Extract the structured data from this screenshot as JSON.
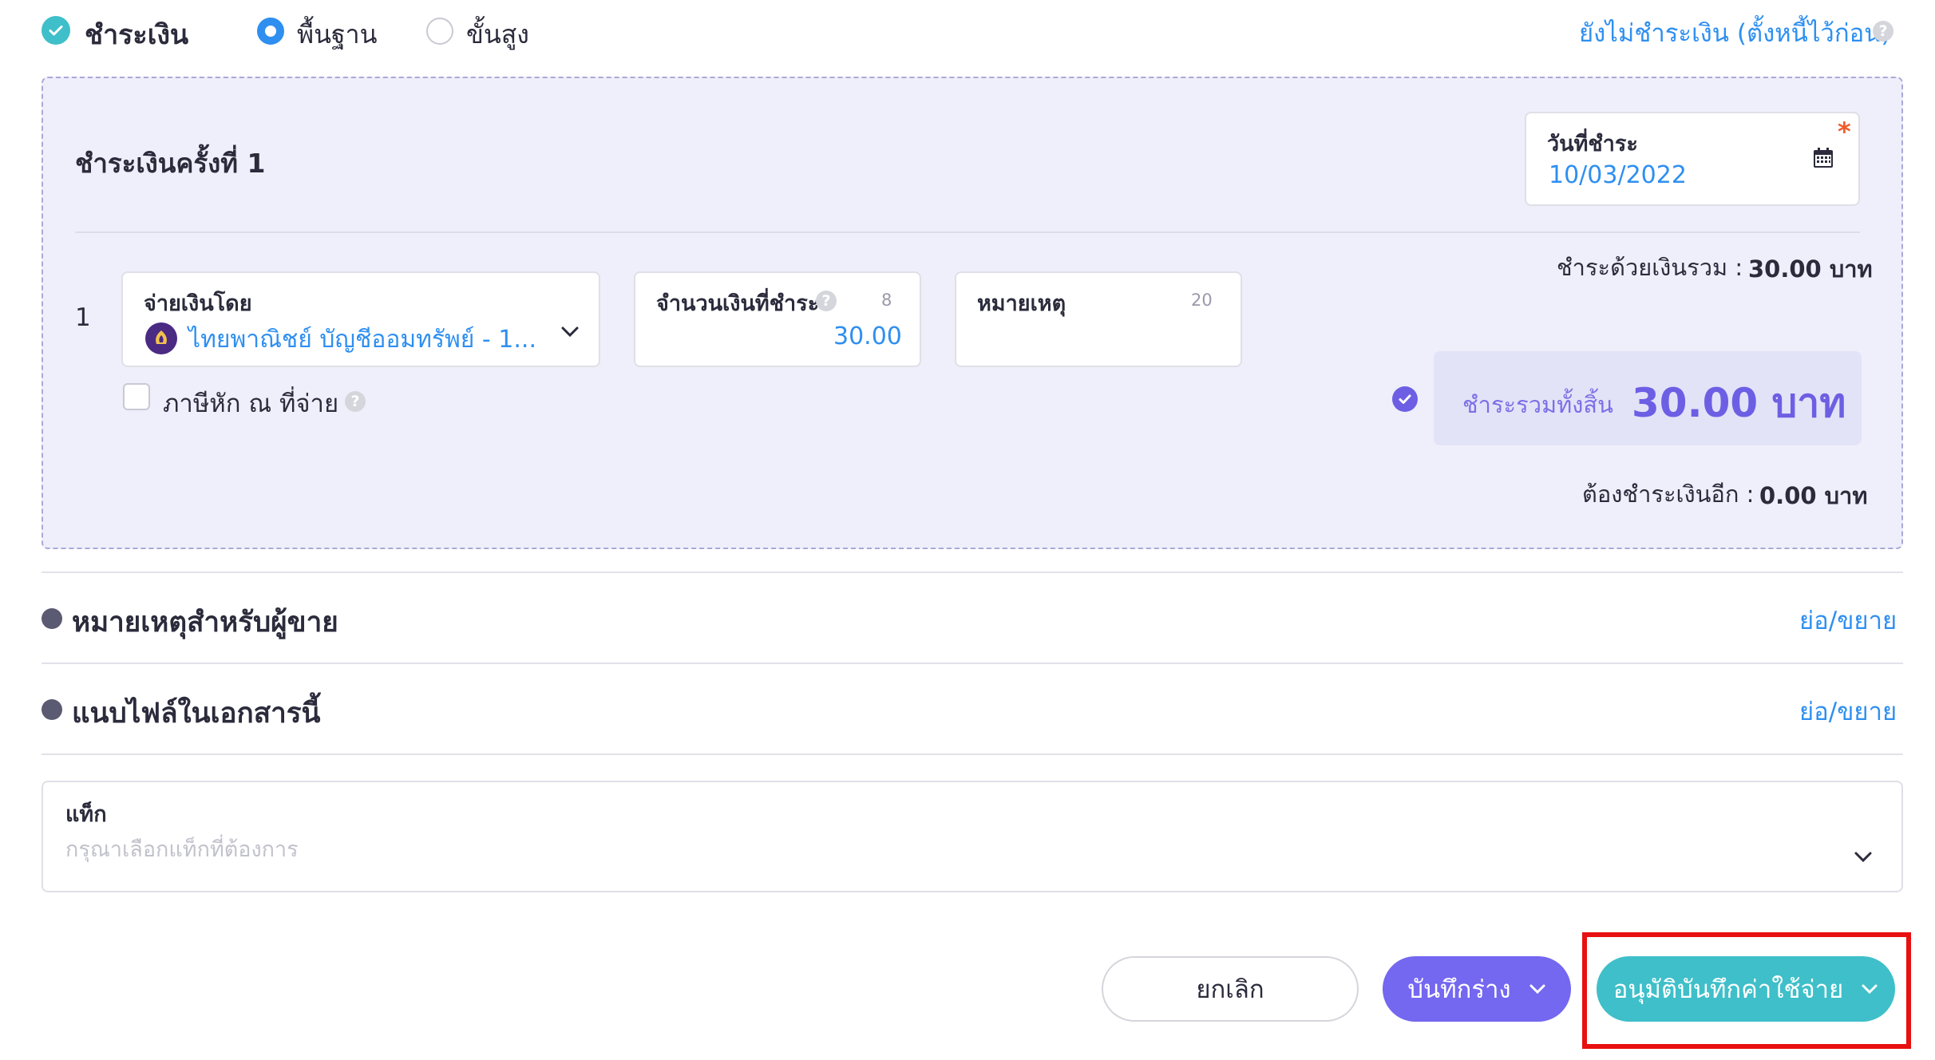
{
  "payment": {
    "title": "ชำระเงิน",
    "mode_basic": "พื้นฐาน",
    "mode_advanced": "ขั้นสูง",
    "unpaid_link": "ยังไม่ชำระเงิน (ตั้งหนี้ไว้ก่อน)"
  },
  "panel": {
    "title": "ชำระเงินครั้งที่ 1",
    "pay_date_label": "วันที่ชำระ",
    "pay_date_value": "10/03/2022",
    "required_mark": "*",
    "row_number": "1",
    "pay_by_label": "จ่ายเงินโดย",
    "pay_by_value": "ไทยพาณิชย์ บัญชีออมทรัพย์ - 1...",
    "amount_label": "จำนวนเงินที่ชำระ",
    "amount_counter": "8",
    "amount_value": "30.00",
    "note_label": "หมายเหตุ",
    "note_counter": "20",
    "withholding_label": "ภาษีหัก ณ ที่จ่าย",
    "paid_total_label": "ชำระด้วยเงินรวม :",
    "paid_total_value": "30.00 บาท",
    "grand_total_label": "ชำระรวมทั้งสิ้น",
    "grand_total_value": "30.00 บาท",
    "remaining_label": "ต้องชำระเงินอีก :",
    "remaining_value": "0.00 บาท"
  },
  "sections": {
    "seller_note": "หมายเหตุสำหรับผู้ขาย",
    "attach_files": "แนบไฟล์ในเอกสารนี้",
    "toggle": "ย่อ/ขยาย"
  },
  "tag": {
    "label": "แท็ก",
    "placeholder": "กรุณาเลือกแท็กที่ต้องการ"
  },
  "actions": {
    "cancel": "ยกเลิก",
    "save_draft": "บันทึกร่าง",
    "approve": "อนุมัติบันทึกค่าใช้จ่าย"
  },
  "colors": {
    "accent_teal": "#3fbfc9",
    "accent_purple": "#7467f0",
    "link_blue": "#2e8ff0",
    "highlight_red": "#e81010"
  }
}
